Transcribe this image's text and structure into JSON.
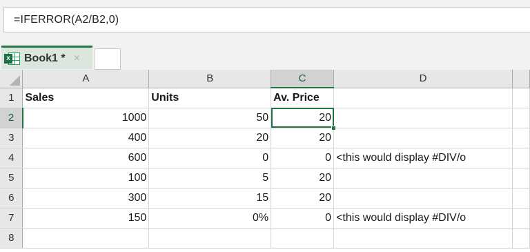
{
  "formula_bar": {
    "text": "=IFERROR(A2/B2,0)"
  },
  "workbook_tab": {
    "name": "Book1 *",
    "close_glyph": "×",
    "icon_letter": "x"
  },
  "columns": [
    "A",
    "B",
    "C",
    "D"
  ],
  "rows": [
    {
      "num": "1",
      "a": "Sales",
      "b": "Units",
      "c": "Av. Price",
      "d": ""
    },
    {
      "num": "2",
      "a": "1000",
      "b": "50",
      "c": "20",
      "d": ""
    },
    {
      "num": "3",
      "a": "400",
      "b": "20",
      "c": "20",
      "d": ""
    },
    {
      "num": "4",
      "a": "600",
      "b": "0",
      "c": "0",
      "d": "<this would display #DIV/o"
    },
    {
      "num": "5",
      "a": "100",
      "b": "5",
      "c": "20",
      "d": ""
    },
    {
      "num": "6",
      "a": "300",
      "b": "15",
      "c": "20",
      "d": ""
    },
    {
      "num": "7",
      "a": "150",
      "b": "0%",
      "c": "0",
      "d": "<this would display #DIV/o"
    },
    {
      "num": "8",
      "a": "",
      "b": "",
      "c": "",
      "d": ""
    }
  ],
  "selection": {
    "cell": "C2",
    "accent_color": "#217346"
  }
}
